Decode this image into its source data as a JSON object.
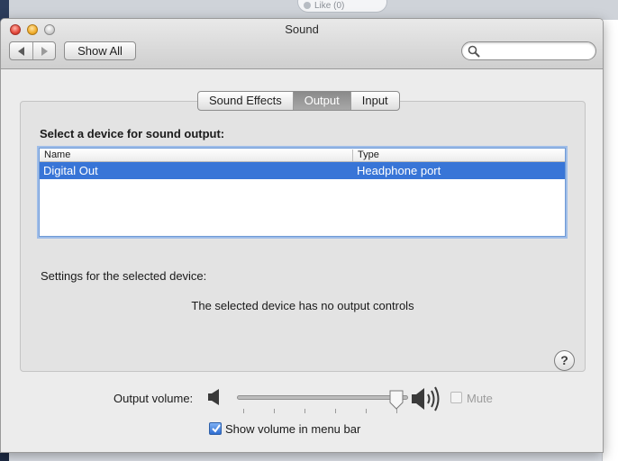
{
  "background": {
    "like_button": "Like (0)"
  },
  "window": {
    "title": "Sound",
    "show_all": "Show All",
    "search": {
      "placeholder": "",
      "value": ""
    }
  },
  "tabs": [
    {
      "label": "Sound Effects",
      "active": false
    },
    {
      "label": "Output",
      "active": true
    },
    {
      "label": "Input",
      "active": false
    }
  ],
  "output": {
    "select_label": "Select a device for sound output:",
    "columns": [
      "Name",
      "Type"
    ],
    "devices": [
      {
        "name": "Digital Out",
        "type": "Headphone port",
        "selected": true
      }
    ],
    "settings_label": "Settings for the selected device:",
    "no_controls_message": "The selected device has no output controls",
    "help": "?"
  },
  "volume": {
    "label": "Output volume:",
    "level": 0.93,
    "mute_label": "Mute",
    "muted": false,
    "mute_enabled": false
  },
  "menu_bar": {
    "label": "Show volume in menu bar",
    "checked": true
  },
  "colors": {
    "selection": "#3875d7",
    "active_tab": "#959595",
    "focus_ring": "#9fbde8"
  }
}
